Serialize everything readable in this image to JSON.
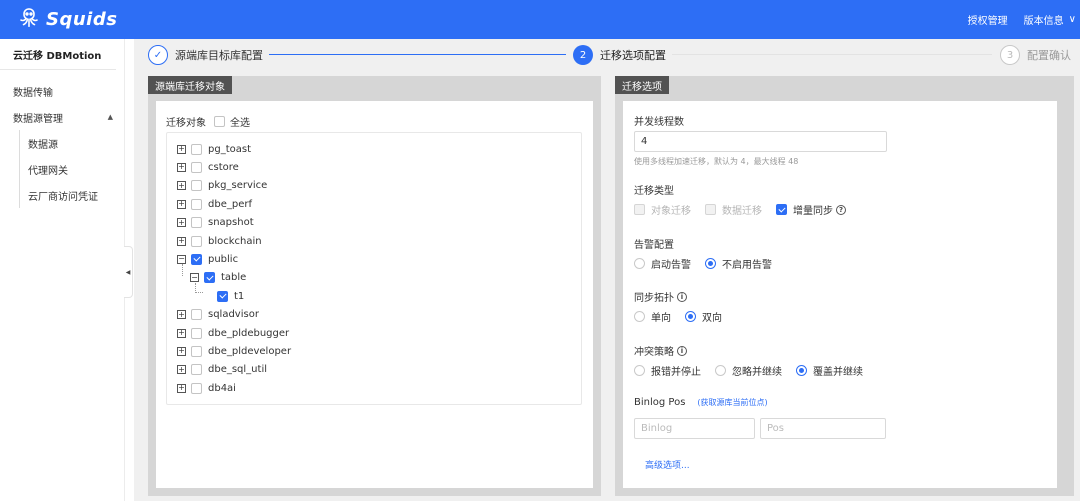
{
  "header": {
    "brand": "Squids",
    "links": [
      "授权管理",
      "版本信息"
    ],
    "version_chevron": "∨"
  },
  "sidebar": {
    "title": "云迁移 DBMotion",
    "items": [
      {
        "label": "数据传输"
      },
      {
        "label": "数据源管理",
        "caret": "▲"
      }
    ],
    "subitems": [
      {
        "label": "数据源"
      },
      {
        "label": "代理网关"
      },
      {
        "label": "云厂商访问凭证"
      }
    ],
    "collapse_glyph": "◀"
  },
  "steps": [
    {
      "num": "✓",
      "label": "源端库目标库配置",
      "state": "done"
    },
    {
      "num": "2",
      "label": "迁移选项配置",
      "state": "active"
    },
    {
      "num": "3",
      "label": "配置确认",
      "state": "pending"
    }
  ],
  "left_panel": {
    "tab": "源端库迁移对象",
    "header_label": "迁移对象",
    "select_all_label": "全选",
    "tree": [
      {
        "label": "pg_toast",
        "level": 0,
        "expander": "+",
        "checked": false
      },
      {
        "label": "cstore",
        "level": 0,
        "expander": "+",
        "checked": false
      },
      {
        "label": "pkg_service",
        "level": 0,
        "expander": "+",
        "checked": false
      },
      {
        "label": "dbe_perf",
        "level": 0,
        "expander": "+",
        "checked": false
      },
      {
        "label": "snapshot",
        "level": 0,
        "expander": "+",
        "checked": false
      },
      {
        "label": "blockchain",
        "level": 0,
        "expander": "+",
        "checked": false
      },
      {
        "label": "public",
        "level": 0,
        "expander": "−",
        "checked": true
      },
      {
        "label": "table",
        "level": 1,
        "expander": "−",
        "checked": true
      },
      {
        "label": "t1",
        "level": 2,
        "expander": "",
        "checked": true
      },
      {
        "label": "sqladvisor",
        "level": 0,
        "expander": "+",
        "checked": false
      },
      {
        "label": "dbe_pldebugger",
        "level": 0,
        "expander": "+",
        "checked": false
      },
      {
        "label": "dbe_pldeveloper",
        "level": 0,
        "expander": "+",
        "checked": false
      },
      {
        "label": "dbe_sql_util",
        "level": 0,
        "expander": "+",
        "checked": false
      },
      {
        "label": "db4ai",
        "level": 0,
        "expander": "+",
        "checked": false
      }
    ]
  },
  "right_panel": {
    "tab": "迁移选项",
    "threads": {
      "label": "并发线程数",
      "value": "4",
      "hint": "使用多线程加速迁移，默认为 4，最大线程 48"
    },
    "migration_type": {
      "label": "迁移类型",
      "options": [
        {
          "label": "对象迁移",
          "checked": false,
          "disabled": true
        },
        {
          "label": "数据迁移",
          "checked": false,
          "disabled": true
        },
        {
          "label": "增量同步",
          "checked": true,
          "disabled": false,
          "help": "?"
        }
      ]
    },
    "alert": {
      "label": "告警配置",
      "options": [
        {
          "label": "启动告警",
          "checked": false
        },
        {
          "label": "不启用告警",
          "checked": true
        }
      ]
    },
    "topology": {
      "label": "同步拓扑",
      "info": "i",
      "options": [
        {
          "label": "单向",
          "checked": false
        },
        {
          "label": "双向",
          "checked": true
        }
      ]
    },
    "conflict": {
      "label": "冲突策略",
      "info": "i",
      "options": [
        {
          "label": "报错并停止",
          "checked": false
        },
        {
          "label": "忽略并继续",
          "checked": false
        },
        {
          "label": "覆盖并继续",
          "checked": true
        }
      ]
    },
    "binlog": {
      "label": "Binlog Pos",
      "fetch_link": "(获取源库当前位点)",
      "binlog_placeholder": "Binlog",
      "pos_placeholder": "Pos"
    },
    "advanced_link": "高级选项..."
  },
  "colors": {
    "brand_blue": "#2d6ef5",
    "panel_tab": "#525252",
    "panel_bg": "#d6d6d6"
  }
}
